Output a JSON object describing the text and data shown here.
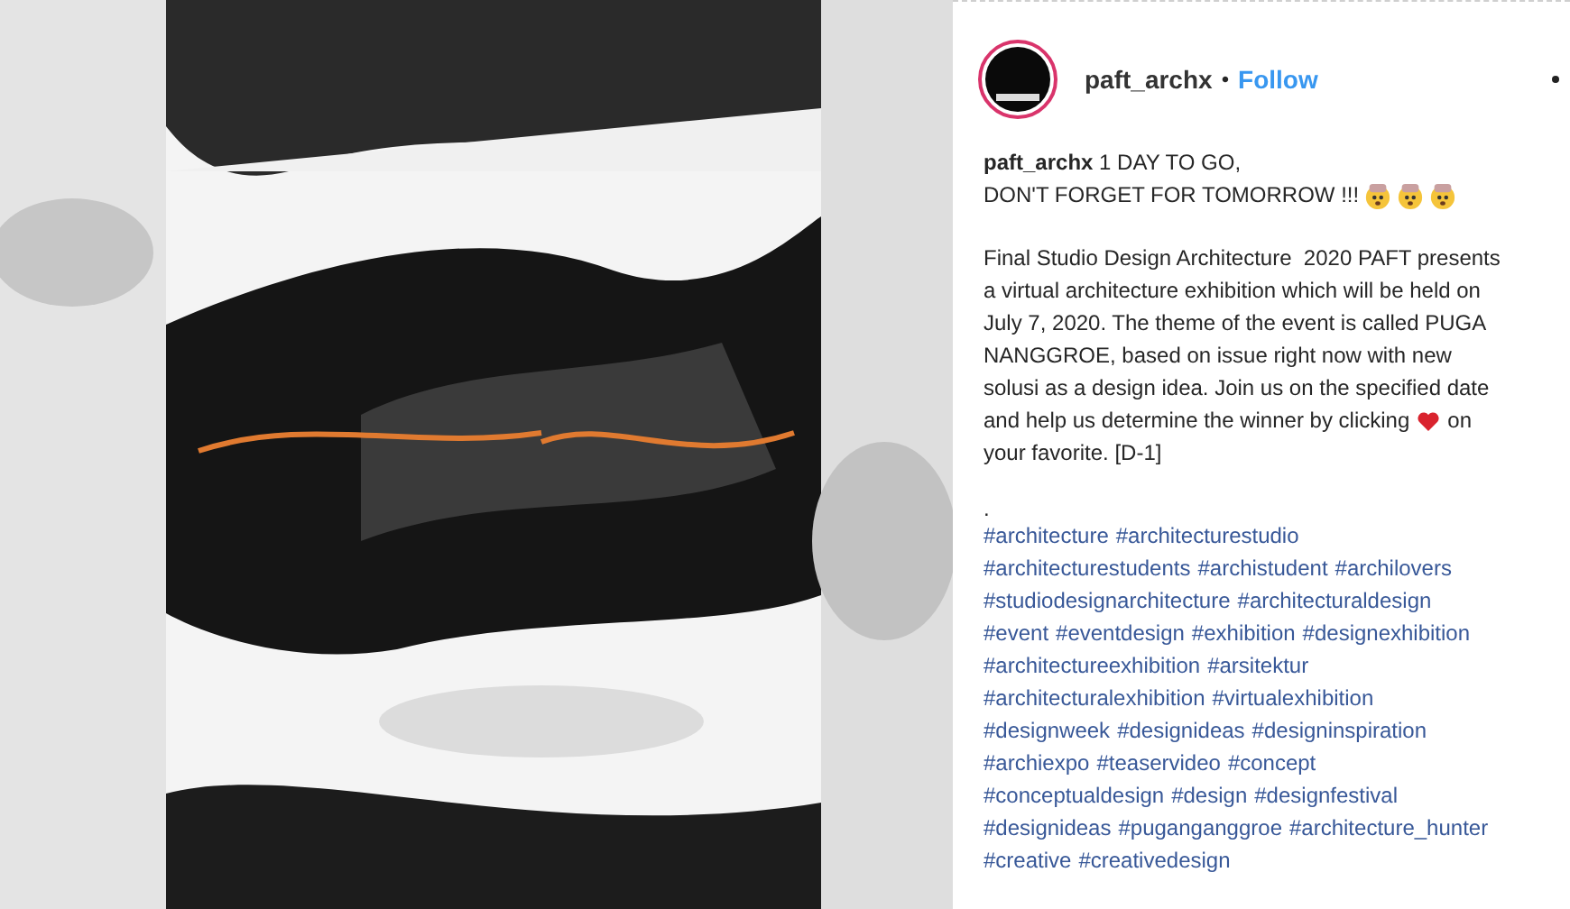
{
  "post": {
    "header": {
      "username": "paft_archx",
      "separator": "•",
      "follow": "Follow"
    },
    "caption": {
      "username": "paft_archx",
      "line_1": "1 DAY TO GO,",
      "line_2": "DON'T FORGET FOR TOMORROW !!!",
      "body_lines": [
        "Final Studio Design Architecture  2020 PAFT presents",
        "a virtual architecture exhibition which will be held on",
        "July 7, 2020. The theme of the event is called PUGA",
        "NANGGROE, based on issue right now with new",
        "solusi as a design idea. Join us on the specified date"
      ],
      "heart_line_before": "and help us determine the winner by clicking",
      "heart_line_after": "on",
      "last_line": "your favorite. [D-1]",
      "dot": ".",
      "hashtag_lines": [
        [
          "#architecture",
          "#architecturestudio"
        ],
        [
          "#architecturestudents",
          "#archistudent",
          "#archilovers"
        ],
        [
          "#studiodesignarchitecture",
          "#architecturaldesign"
        ],
        [
          "#event",
          "#eventdesign",
          "#exhibition",
          "#designexhibition"
        ],
        [
          "#architectureexhibition",
          "#arsitektur"
        ],
        [
          "#architecturalexhibition",
          "#virtualexhibition"
        ],
        [
          "#designweek",
          "#designideas",
          "#designinspiration"
        ],
        [
          "#archiexpo",
          "#teaservideo",
          "#concept"
        ],
        [
          "#conceptualdesign",
          "#design",
          "#designfestival"
        ],
        [
          "#designideas",
          "#puganganggroe",
          "#architecture_hunter"
        ],
        [
          "#creative",
          "#creativedesign"
        ]
      ]
    }
  }
}
